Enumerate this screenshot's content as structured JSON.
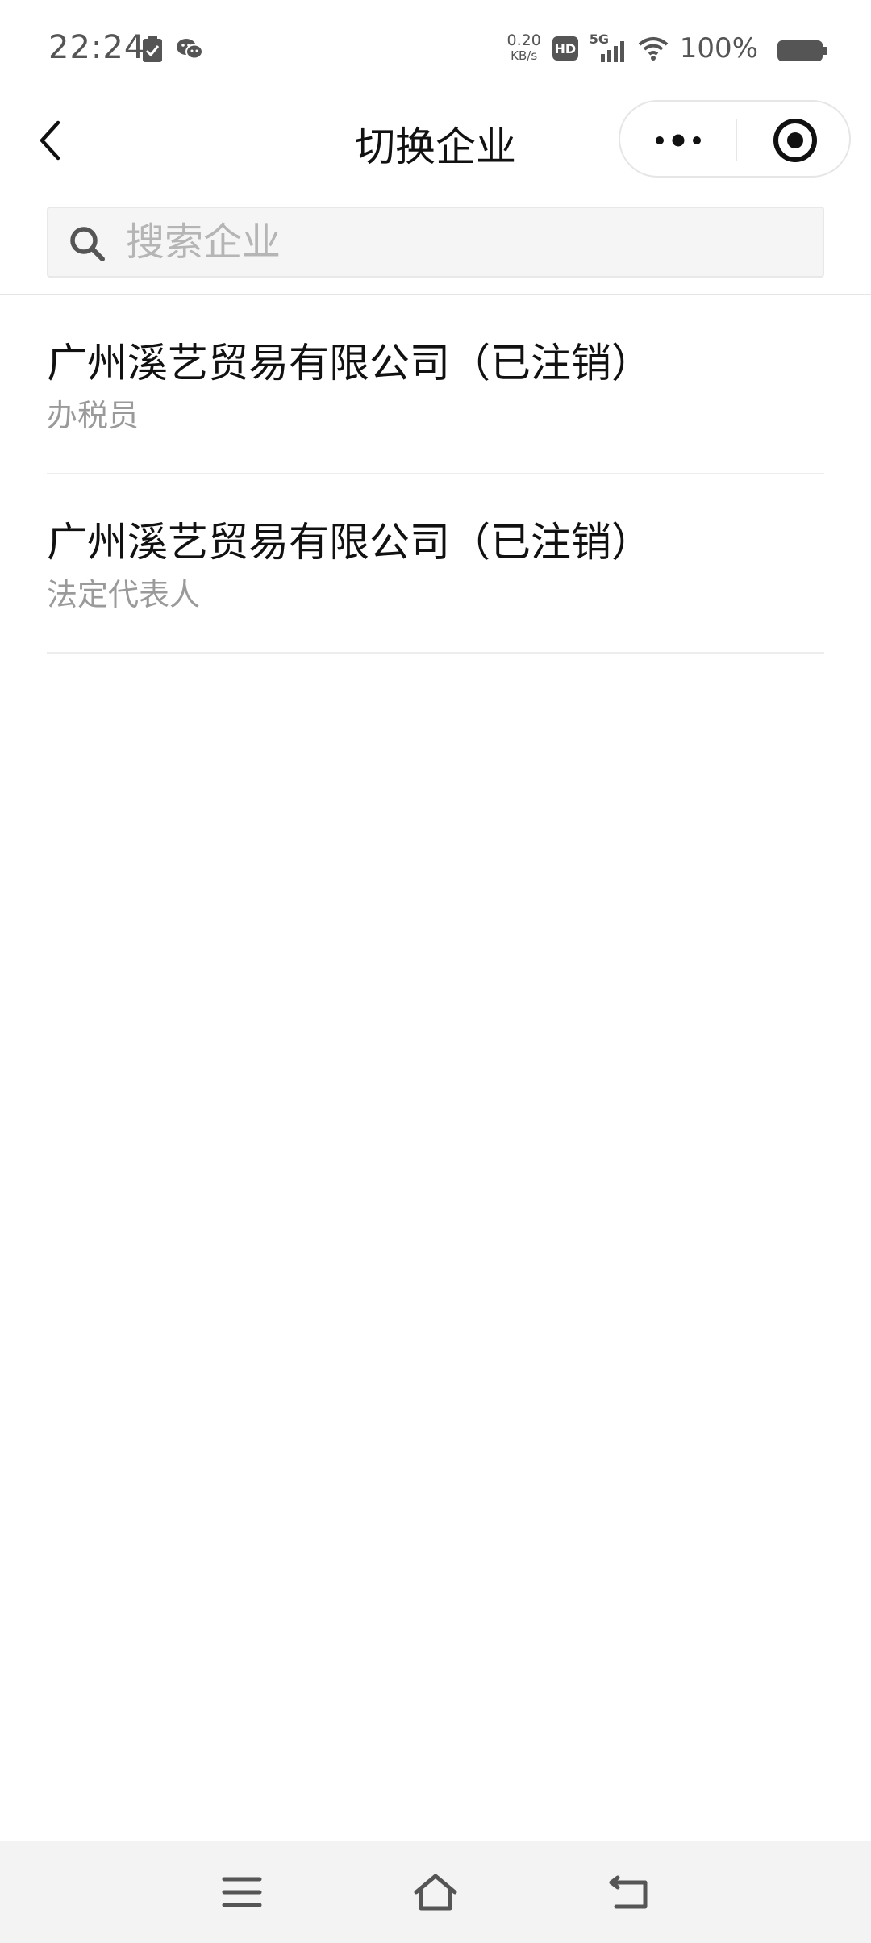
{
  "status_bar": {
    "time": "22:24",
    "net_speed_value": "0.20",
    "net_speed_unit": "KB/s",
    "hd_label": "HD",
    "network_label": "5G",
    "battery": "100%"
  },
  "nav": {
    "title": "切换企业"
  },
  "search": {
    "placeholder": "搜索企业",
    "value": ""
  },
  "companies": [
    {
      "name": "广州溪艺贸易有限公司（已注销）",
      "role": "办税员"
    },
    {
      "name": "广州溪艺贸易有限公司（已注销）",
      "role": "法定代表人"
    }
  ],
  "colors": {
    "text_primary": "#111111",
    "text_secondary": "#9a9a9a",
    "divider": "#ededed",
    "search_bg": "#f5f5f5"
  }
}
